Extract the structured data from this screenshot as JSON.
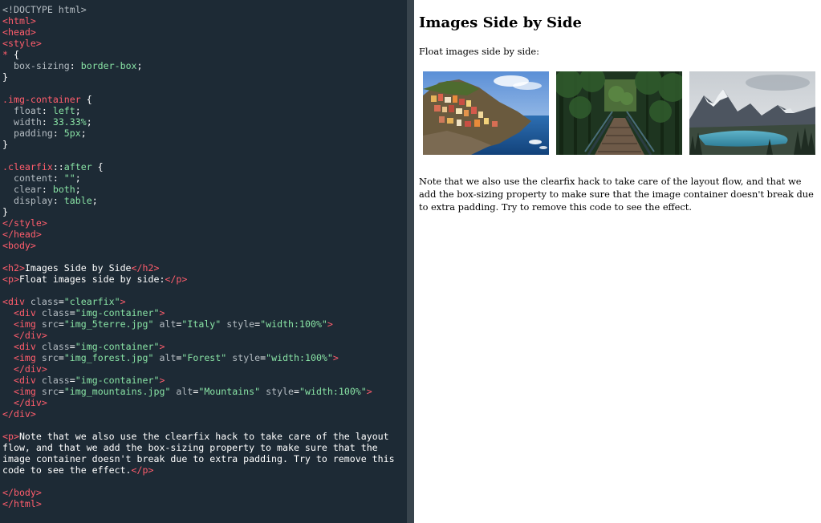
{
  "editor": {
    "lines": [
      [
        [
          "doc",
          "<!DOCTYPE html>"
        ]
      ],
      [
        [
          "tag",
          "<html>"
        ]
      ],
      [
        [
          "tag",
          "<head>"
        ]
      ],
      [
        [
          "tag",
          "<style>"
        ]
      ],
      [
        [
          "sel",
          "* "
        ],
        [
          "punc",
          "{"
        ]
      ],
      [
        [
          "prop",
          "  box-sizing"
        ],
        [
          "punc",
          ": "
        ],
        [
          "pv",
          "border-box"
        ],
        [
          "punc",
          ";"
        ]
      ],
      [
        [
          "punc",
          "}"
        ]
      ],
      [],
      [
        [
          "sel",
          ".img-container "
        ],
        [
          "punc",
          "{"
        ]
      ],
      [
        [
          "prop",
          "  float"
        ],
        [
          "punc",
          ": "
        ],
        [
          "pv",
          "left"
        ],
        [
          "punc",
          ";"
        ]
      ],
      [
        [
          "prop",
          "  width"
        ],
        [
          "punc",
          ": "
        ],
        [
          "pv",
          "33.33%"
        ],
        [
          "punc",
          ";"
        ]
      ],
      [
        [
          "prop",
          "  padding"
        ],
        [
          "punc",
          ": "
        ],
        [
          "pv",
          "5px"
        ],
        [
          "punc",
          ";"
        ]
      ],
      [
        [
          "punc",
          "}"
        ]
      ],
      [],
      [
        [
          "sel",
          ".clearfix"
        ],
        [
          "punc",
          "::"
        ],
        [
          "pseudo",
          "after"
        ],
        [
          "punc",
          " {"
        ]
      ],
      [
        [
          "prop",
          "  content"
        ],
        [
          "punc",
          ": "
        ],
        [
          "pv",
          "\"\""
        ],
        [
          "punc",
          ";"
        ]
      ],
      [
        [
          "prop",
          "  clear"
        ],
        [
          "punc",
          ": "
        ],
        [
          "pv",
          "both"
        ],
        [
          "punc",
          ";"
        ]
      ],
      [
        [
          "prop",
          "  display"
        ],
        [
          "punc",
          ": "
        ],
        [
          "pv",
          "table"
        ],
        [
          "punc",
          ";"
        ]
      ],
      [
        [
          "punc",
          "}"
        ]
      ],
      [
        [
          "tag",
          "</style>"
        ]
      ],
      [
        [
          "tag",
          "</head>"
        ]
      ],
      [
        [
          "tag",
          "<body>"
        ]
      ],
      [],
      [
        [
          "tag",
          "<h2>"
        ],
        [
          "text",
          "Images Side by Side"
        ],
        [
          "tag",
          "</h2>"
        ]
      ],
      [
        [
          "tag",
          "<p>"
        ],
        [
          "text",
          "Float images side by side:"
        ],
        [
          "tag",
          "</p>"
        ]
      ],
      [],
      [
        [
          "tag",
          "<div "
        ],
        [
          "attr",
          "class"
        ],
        [
          "punc",
          "="
        ],
        [
          "val",
          "\"clearfix\""
        ],
        [
          "tag",
          ">"
        ]
      ],
      [
        [
          "tag",
          "  <div "
        ],
        [
          "attr",
          "class"
        ],
        [
          "punc",
          "="
        ],
        [
          "val",
          "\"img-container\""
        ],
        [
          "tag",
          ">"
        ]
      ],
      [
        [
          "tag",
          "  <img "
        ],
        [
          "attr",
          "src"
        ],
        [
          "punc",
          "="
        ],
        [
          "val",
          "\"img_5terre.jpg\""
        ],
        [
          "attr",
          " alt"
        ],
        [
          "punc",
          "="
        ],
        [
          "val",
          "\"Italy\""
        ],
        [
          "attr",
          " style"
        ],
        [
          "punc",
          "="
        ],
        [
          "val",
          "\"width:100%\""
        ],
        [
          "tag",
          ">"
        ]
      ],
      [
        [
          "tag",
          "  </div>"
        ]
      ],
      [
        [
          "tag",
          "  <div "
        ],
        [
          "attr",
          "class"
        ],
        [
          "punc",
          "="
        ],
        [
          "val",
          "\"img-container\""
        ],
        [
          "tag",
          ">"
        ]
      ],
      [
        [
          "tag",
          "  <img "
        ],
        [
          "attr",
          "src"
        ],
        [
          "punc",
          "="
        ],
        [
          "val",
          "\"img_forest.jpg\""
        ],
        [
          "attr",
          " alt"
        ],
        [
          "punc",
          "="
        ],
        [
          "val",
          "\"Forest\""
        ],
        [
          "attr",
          " style"
        ],
        [
          "punc",
          "="
        ],
        [
          "val",
          "\"width:100%\""
        ],
        [
          "tag",
          ">"
        ]
      ],
      [
        [
          "tag",
          "  </div>"
        ]
      ],
      [
        [
          "tag",
          "  <div "
        ],
        [
          "attr",
          "class"
        ],
        [
          "punc",
          "="
        ],
        [
          "val",
          "\"img-container\""
        ],
        [
          "tag",
          ">"
        ]
      ],
      [
        [
          "tag",
          "  <img "
        ],
        [
          "attr",
          "src"
        ],
        [
          "punc",
          "="
        ],
        [
          "val",
          "\"img_mountains.jpg\""
        ],
        [
          "attr",
          " alt"
        ],
        [
          "punc",
          "="
        ],
        [
          "val",
          "\"Mountains\""
        ],
        [
          "attr",
          " style"
        ],
        [
          "punc",
          "="
        ],
        [
          "val",
          "\"width:100%\""
        ],
        [
          "tag",
          ">"
        ]
      ],
      [
        [
          "tag",
          "  </div>"
        ]
      ],
      [
        [
          "tag",
          "</div>"
        ]
      ],
      [],
      [
        [
          "tag",
          "<p>"
        ],
        [
          "text",
          "Note that we also use the clearfix hack to take care of the layout"
        ]
      ],
      [
        [
          "text",
          "flow, and that we add the box-sizing property to make sure that the"
        ]
      ],
      [
        [
          "text",
          "image container doesn't break due to extra padding. Try to remove this"
        ]
      ],
      [
        [
          "text",
          "code to see the effect."
        ],
        [
          "tag",
          "</p>"
        ]
      ],
      [],
      [
        [
          "tag",
          "</body>"
        ]
      ],
      [
        [
          "tag",
          "</html>"
        ]
      ]
    ]
  },
  "result": {
    "heading": "Images Side by Side",
    "intro": "Float images side by side:",
    "images": [
      {
        "alt": "Italy"
      },
      {
        "alt": "Forest"
      },
      {
        "alt": "Mountains"
      }
    ],
    "note": "Note that we also use the clearfix hack to take care of the layout flow, and that we add the box-sizing property to make sure that the image container doesn't break due to extra padding. Try to remove this code to see the effect."
  },
  "colors": {
    "editor_bg": "#1d2a35",
    "divider": "#38444d",
    "tag": "#ff5d6c",
    "value": "#88e2a4",
    "attr": "#b4bcc2"
  }
}
